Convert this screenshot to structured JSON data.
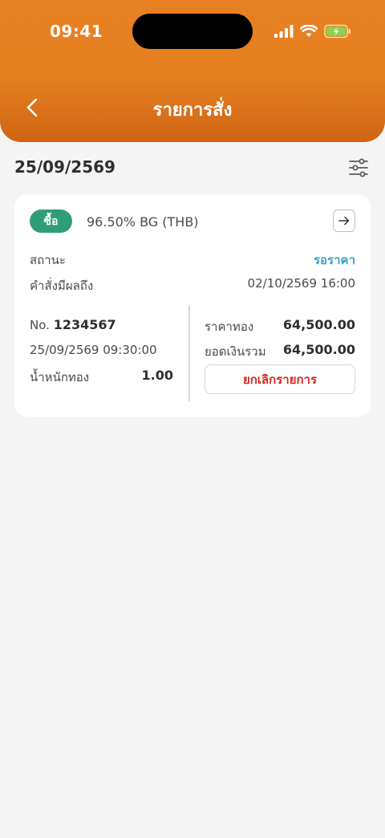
{
  "status_bar": {
    "time": "09:41"
  },
  "nav": {
    "title": "รายการสั่ง"
  },
  "date": "25/09/2569",
  "order": {
    "side": "ซื้อ",
    "product": "96.50% BG (THB)",
    "status_label": "สถานะ",
    "status_value": "รอราคา",
    "effective_label": "คำสั่งมีผลถึง",
    "effective_value": "02/10/2569 16:00",
    "number_prefix": "No.",
    "number": "1234567",
    "created_at": "25/09/2569 09:30:00",
    "weight_label": "น้ำหนักทอง",
    "weight_value": "1.00",
    "price_label": "ราคาทอง",
    "price_value": "64,500.00",
    "total_label": "ยอดเงินรวม",
    "total_value": "64,500.00",
    "cancel_label": "ยกเลิกรายการ"
  },
  "colors": {
    "header": "#e57f20",
    "buy_badge": "#2f9d78",
    "status": "#3aa1c3",
    "cancel": "#cf2a1f"
  }
}
